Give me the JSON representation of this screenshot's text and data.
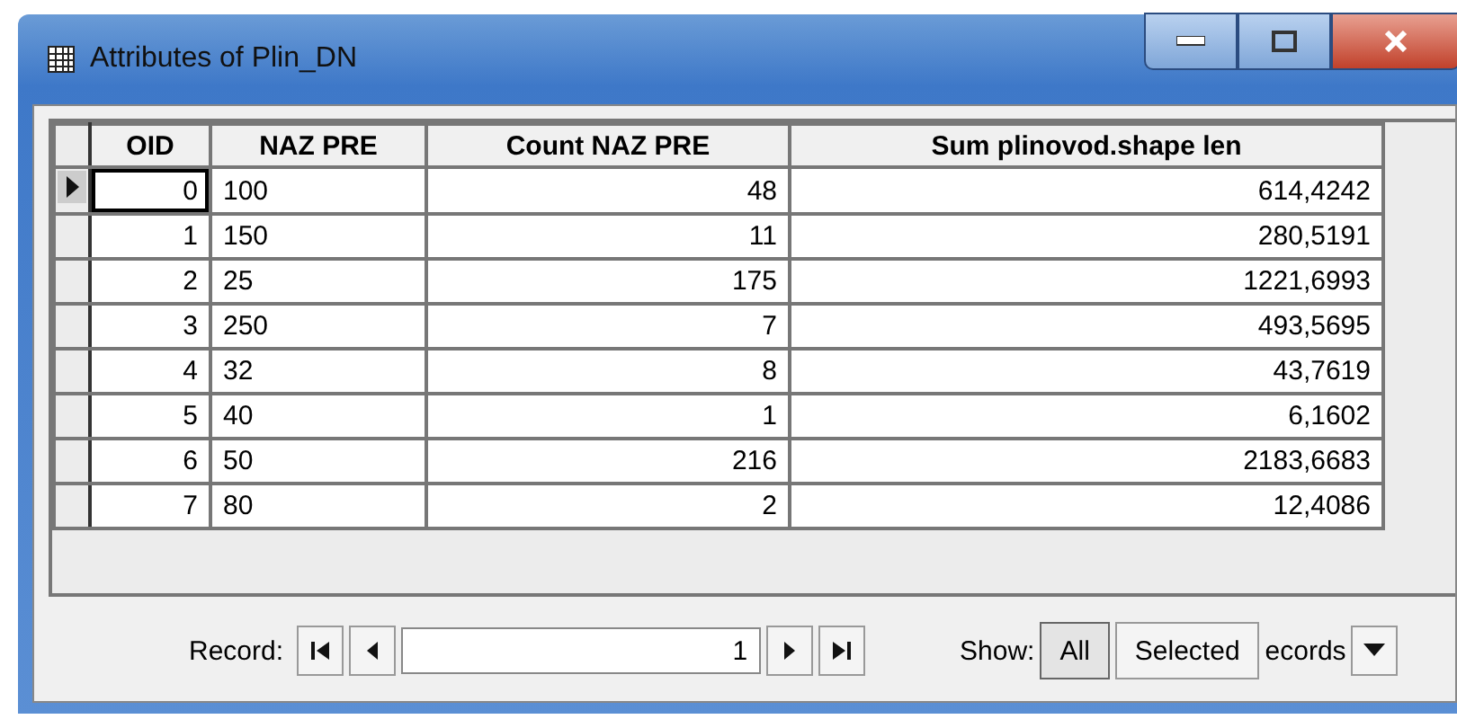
{
  "window": {
    "title": "Attributes of Plin_DN"
  },
  "table": {
    "columns": [
      "OID",
      "NAZ PRE",
      "Count NAZ PRE",
      "Sum plinovod.shape len"
    ],
    "rows": [
      {
        "selected": true,
        "cells": [
          "0",
          "100",
          "48",
          "614,4242"
        ]
      },
      {
        "selected": false,
        "cells": [
          "1",
          "150",
          "11",
          "280,5191"
        ]
      },
      {
        "selected": false,
        "cells": [
          "2",
          "25",
          "175",
          "1221,6993"
        ]
      },
      {
        "selected": false,
        "cells": [
          "3",
          "250",
          "7",
          "493,5695"
        ]
      },
      {
        "selected": false,
        "cells": [
          "4",
          "32",
          "8",
          "43,7619"
        ]
      },
      {
        "selected": false,
        "cells": [
          "5",
          "40",
          "1",
          "6,1602"
        ]
      },
      {
        "selected": false,
        "cells": [
          "6",
          "50",
          "216",
          "2183,6683"
        ]
      },
      {
        "selected": false,
        "cells": [
          "7",
          "80",
          "2",
          "12,4086"
        ]
      }
    ]
  },
  "navigator": {
    "label": "Record:",
    "value": "1"
  },
  "show": {
    "label": "Show:",
    "options": [
      {
        "label": "All",
        "selected": true
      },
      {
        "label": "Selected",
        "selected": false
      }
    ],
    "records_label": "ecords"
  }
}
